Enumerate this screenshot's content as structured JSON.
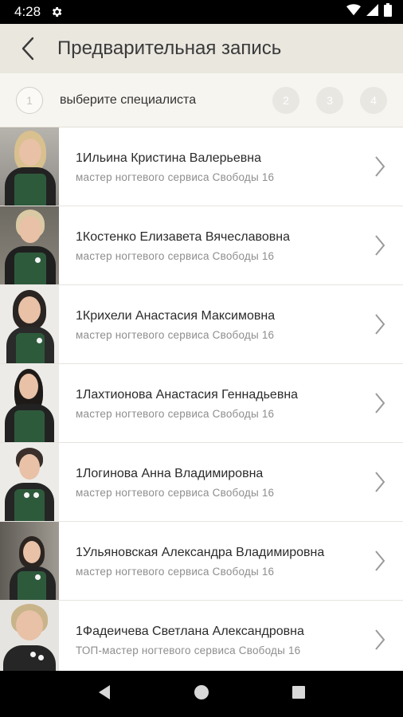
{
  "status_bar": {
    "time": "4:28"
  },
  "app_bar": {
    "title": "Предварительная запись"
  },
  "steps": {
    "current": "1",
    "label": "выберите специалиста",
    "others": [
      "2",
      "3",
      "4"
    ]
  },
  "specialists": [
    {
      "name": "1Ильина Кристина Валерьевна",
      "role": "мастер ногтевого сервиса Свободы 16"
    },
    {
      "name": "1Костенко Елизавета Вячеславовна",
      "role": "мастер ногтевого сервиса Свободы 16"
    },
    {
      "name": "1Крихели Анастасия Максимовна",
      "role": "мастер ногтевого сервиса Свободы 16"
    },
    {
      "name": "1Лахтионова Анастасия Геннадьевна",
      "role": "мастер ногтевого сервиса Свободы 16"
    },
    {
      "name": "1Логинова Анна Владимировна",
      "role": "мастер ногтевого сервиса Свободы 16"
    },
    {
      "name": "1Ульяновская Александра Владимировна",
      "role": "мастер ногтевого сервиса Свободы 16"
    },
    {
      "name": "1Фадеичева Светлана Александровна",
      "role": "ТОП-мастер ногтевого сервиса Свободы 16"
    }
  ],
  "colors": {
    "accent": "#2e5a3c",
    "background": "#f3f1ec",
    "appbar": "#eae7df"
  }
}
